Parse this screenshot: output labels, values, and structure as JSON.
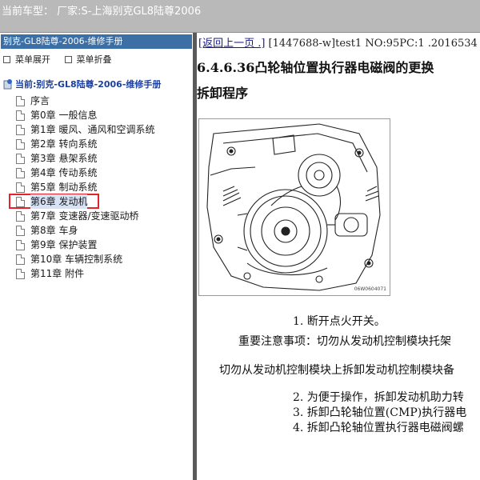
{
  "window": {
    "title": "当前车型：  厂家:S-上海别克GL8陆尊2006"
  },
  "left_panel": {
    "header": "别克-GL8陆尊-2006-维修手册",
    "toggles": [
      "菜单展开",
      "菜单折叠"
    ],
    "root": "当前:别克-GL8陆尊-2006-维修手册",
    "items": [
      {
        "label": "序言"
      },
      {
        "label": "第0章  一般信息"
      },
      {
        "label": "第1章  暖风、通风和空调系统"
      },
      {
        "label": "第2章  转向系统"
      },
      {
        "label": "第3章  悬架系统"
      },
      {
        "label": "第4章  传动系统"
      },
      {
        "label": "第5章  制动系统"
      },
      {
        "label": "第6章  发动机",
        "selected": true
      },
      {
        "label": "第7章  变速器/变速驱动桥"
      },
      {
        "label": "第8章  车身"
      },
      {
        "label": "第9章  保护装置"
      },
      {
        "label": "第10章  车辆控制系统"
      },
      {
        "label": "第11章  附件"
      }
    ]
  },
  "content": {
    "back_link": "[返回上一页 .]",
    "doc_info": " [1447688-w]test1 NO:95PC:1 .2016534",
    "heading": "6.4.6.36凸轮轴位置执行器电磁阀的更换",
    "subheading": "拆卸程序",
    "figure_id": "06W0604071",
    "step1": "1. 断开点火开关。",
    "notice": "重要注意事项：切勿从发动机控制模块托架",
    "warning": "切勿从发动机控制模块上拆卸发动机控制模块备",
    "step2": "2. 为便于操作，拆卸发动机助力转",
    "step3": "3. 拆卸凸轮轴位置(CMP)执行器电",
    "step4": "4. 拆卸凸轮轴位置执行器电磁阀螺"
  }
}
